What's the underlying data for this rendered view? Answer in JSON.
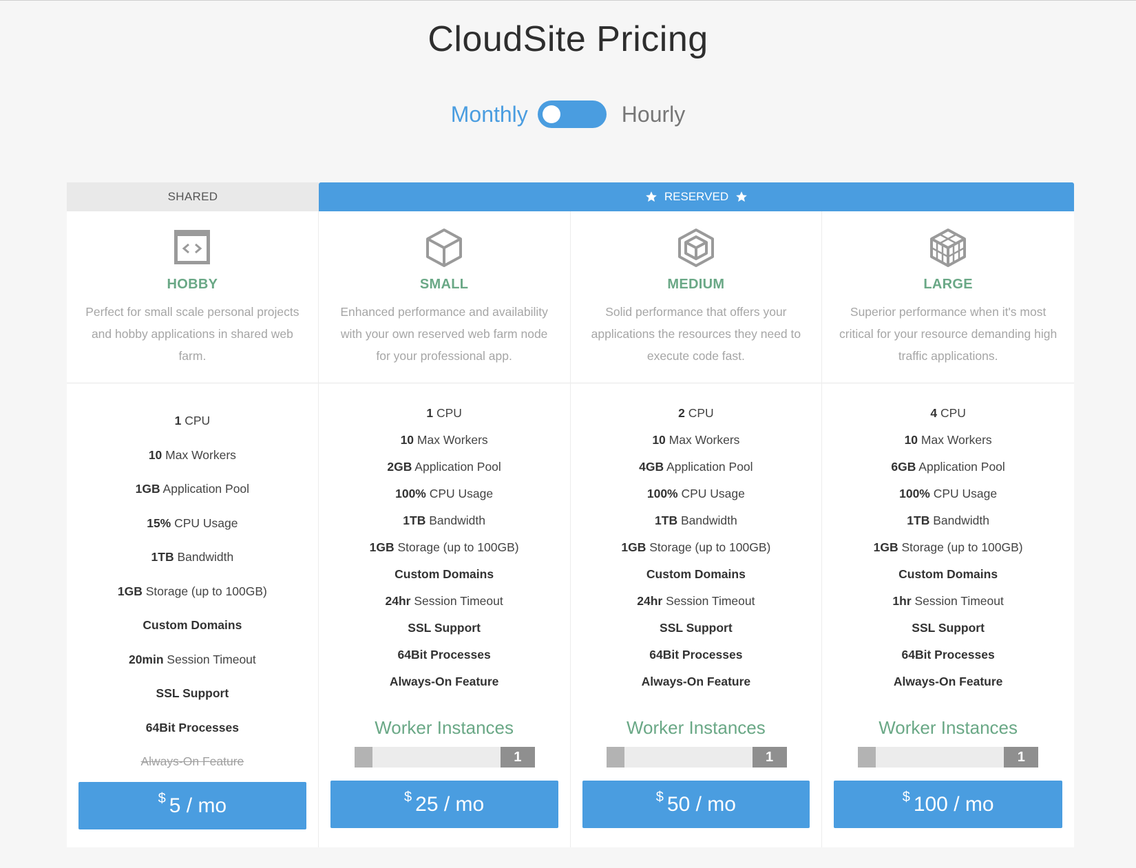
{
  "page": {
    "title": "CloudSite Pricing"
  },
  "billing_toggle": {
    "left_label": "Monthly",
    "right_label": "Hourly",
    "selected": "Monthly"
  },
  "tiers": {
    "shared_label": "SHARED",
    "reserved_label": "RESERVED"
  },
  "colors": {
    "accent": "#4a9de0",
    "plan_name": "#6aa886",
    "muted": "#a6a6a6"
  },
  "plans": [
    {
      "icon": "code-window-icon",
      "name": "HOBBY",
      "description": "Perfect for small scale personal projects and hobby applications in shared web farm.",
      "features": [
        {
          "bold": "1",
          "text": " CPU"
        },
        {
          "bold": "10",
          "text": " Max Workers"
        },
        {
          "bold": "1GB",
          "text": " Application Pool"
        },
        {
          "bold": "15%",
          "text": " CPU Usage"
        },
        {
          "bold": "1TB",
          "text": " Bandwidth"
        },
        {
          "bold": "1GB",
          "text": " Storage (up to 100GB)"
        },
        {
          "bold": "Custom Domains",
          "text": ""
        },
        {
          "bold": "20min",
          "text": " Session Timeout"
        },
        {
          "bold": "SSL Support",
          "text": ""
        },
        {
          "bold": "64Bit Processes",
          "text": ""
        },
        {
          "bold": "",
          "text": "Always-On Feature",
          "strike": true
        }
      ],
      "price_currency": "$",
      "price_text": "5 / mo"
    },
    {
      "icon": "cube-icon",
      "name": "SMALL",
      "description": "Enhanced performance and availability with your own reserved web farm node for your professional app.",
      "features": [
        {
          "bold": "1",
          "text": " CPU"
        },
        {
          "bold": "10",
          "text": " Max Workers"
        },
        {
          "bold": "2GB",
          "text": " Application Pool"
        },
        {
          "bold": "100%",
          "text": " CPU Usage"
        },
        {
          "bold": "1TB",
          "text": " Bandwidth"
        },
        {
          "bold": "1GB",
          "text": " Storage (up to 100GB)"
        },
        {
          "bold": "Custom Domains",
          "text": ""
        },
        {
          "bold": "24hr",
          "text": " Session Timeout"
        },
        {
          "bold": "SSL Support",
          "text": ""
        },
        {
          "bold": "64Bit Processes",
          "text": ""
        },
        {
          "bold": "Always-On Feature",
          "text": ""
        }
      ],
      "workers_title": "Worker Instances",
      "workers_count": "1",
      "price_currency": "$",
      "price_text": "25 / mo"
    },
    {
      "icon": "cube-layered-icon",
      "name": "MEDIUM",
      "description": "Solid performance that offers your applications the resources they need to execute code fast.",
      "features": [
        {
          "bold": "2",
          "text": " CPU"
        },
        {
          "bold": "10",
          "text": " Max Workers"
        },
        {
          "bold": "4GB",
          "text": " Application Pool"
        },
        {
          "bold": "100%",
          "text": " CPU Usage"
        },
        {
          "bold": "1TB",
          "text": " Bandwidth"
        },
        {
          "bold": "1GB",
          "text": " Storage (up to 100GB)"
        },
        {
          "bold": "Custom Domains",
          "text": ""
        },
        {
          "bold": "24hr",
          "text": " Session Timeout"
        },
        {
          "bold": "SSL Support",
          "text": ""
        },
        {
          "bold": "64Bit Processes",
          "text": ""
        },
        {
          "bold": "Always-On Feature",
          "text": ""
        }
      ],
      "workers_title": "Worker Instances",
      "workers_count": "1",
      "price_currency": "$",
      "price_text": "50 / mo"
    },
    {
      "icon": "cube-grid-icon",
      "name": "LARGE",
      "description": "Superior performance when it's most critical for your resource demanding high traffic applications.",
      "features": [
        {
          "bold": "4",
          "text": " CPU"
        },
        {
          "bold": "10",
          "text": " Max Workers"
        },
        {
          "bold": "6GB",
          "text": " Application Pool"
        },
        {
          "bold": "100%",
          "text": " CPU Usage"
        },
        {
          "bold": "1TB",
          "text": " Bandwidth"
        },
        {
          "bold": "1GB",
          "text": " Storage (up to 100GB)"
        },
        {
          "bold": "Custom Domains",
          "text": ""
        },
        {
          "bold": "1hr",
          "text": " Session Timeout"
        },
        {
          "bold": "SSL Support",
          "text": ""
        },
        {
          "bold": "64Bit Processes",
          "text": ""
        },
        {
          "bold": "Always-On Feature",
          "text": ""
        }
      ],
      "workers_title": "Worker Instances",
      "workers_count": "1",
      "price_currency": "$",
      "price_text": "100 / mo"
    }
  ]
}
